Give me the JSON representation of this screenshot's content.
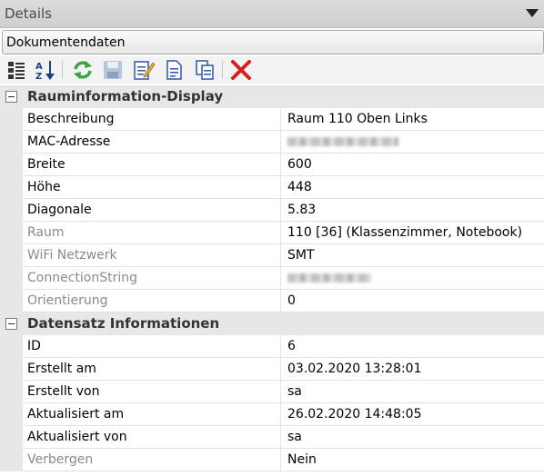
{
  "panel": {
    "title": "Details"
  },
  "document_selector": {
    "value": "Dokumentendaten"
  },
  "toolbar": {
    "icons": [
      "categorized-icon",
      "sort-alpha-icon",
      "refresh-icon",
      "save-icon",
      "edit-icon",
      "document-icon",
      "copy-icon",
      "delete-icon"
    ]
  },
  "categories": [
    {
      "label": "Rauminformation-Display",
      "rows": [
        {
          "name": "Beschreibung",
          "value": "Raum 110 Oben Links",
          "readonly": false
        },
        {
          "name": "MAC-Adresse",
          "value": "",
          "blurred": true,
          "readonly": false
        },
        {
          "name": "Breite",
          "value": "600",
          "readonly": false
        },
        {
          "name": "Höhe",
          "value": "448",
          "readonly": false
        },
        {
          "name": "Diagonale",
          "value": "5.83",
          "readonly": false
        },
        {
          "name": "Raum",
          "value": "110 [36] (Klassenzimmer, Notebook)",
          "readonly": true
        },
        {
          "name": "WiFi Netzwerk",
          "value": "SMT",
          "readonly": true
        },
        {
          "name": "ConnectionString",
          "value": "",
          "blurred": true,
          "readonly": true
        },
        {
          "name": "Orientierung",
          "value": "0",
          "readonly": true
        }
      ]
    },
    {
      "label": "Datensatz Informationen",
      "rows": [
        {
          "name": "ID",
          "value": "6",
          "readonly": false
        },
        {
          "name": "Erstellt am",
          "value": "03.02.2020 13:28:01",
          "readonly": false
        },
        {
          "name": "Erstellt von",
          "value": "sa",
          "readonly": false
        },
        {
          "name": "Aktualisiert am",
          "value": "26.02.2020 14:48:05",
          "readonly": false
        },
        {
          "name": "Aktualisiert von",
          "value": "sa",
          "readonly": false
        },
        {
          "name": "Verbergen",
          "value": "Nein",
          "readonly": true
        }
      ]
    }
  ],
  "colors": {
    "category_bg": "#e7e7e7",
    "readonly_text": "#8a8a8a",
    "delete_red": "#d42020"
  }
}
